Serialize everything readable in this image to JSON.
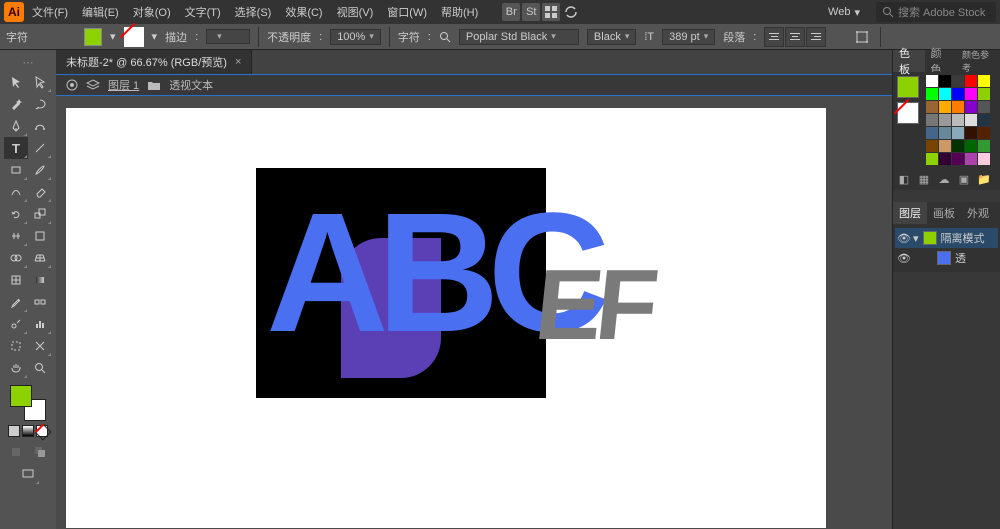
{
  "app_icon_text": "Ai",
  "menus": [
    "文件(F)",
    "编辑(E)",
    "对象(O)",
    "文字(T)",
    "选择(S)",
    "效果(C)",
    "视图(V)",
    "窗口(W)",
    "帮助(H)"
  ],
  "workspace": "Web",
  "search_placeholder": "搜索 Adobe Stock",
  "toolbar": {
    "char_label": "字符",
    "stroke_label": "描边",
    "stroke_val": "",
    "opacity_label": "不透明度",
    "opacity_val": "100%",
    "charset_label": "字符",
    "font_name": "Poplar Std Black",
    "font_style": "Black",
    "font_size": "389 pt",
    "para_label": "段落"
  },
  "tab_title": "未标题-2* @ 66.67% (RGB/预览)",
  "layerbar": {
    "layer_label": "图层 1",
    "item_label": "透视文本"
  },
  "panels": {
    "color_tabs": [
      "色板",
      "颜色",
      "颜色参考"
    ],
    "layer_tabs": [
      "图层",
      "画板",
      "外观"
    ],
    "layer1": "隔离模式",
    "layer2": "透"
  },
  "swatch_colors": [
    "#ffffff",
    "#000000",
    "#3a3a3a",
    "#ff0000",
    "#ffff00",
    "#00ff00",
    "#00ffff",
    "#0000ff",
    "#ff00ff",
    "#8ed100",
    "#996633",
    "#ffaa00",
    "#ff7c00",
    "#8800cc",
    "#555555",
    "#777777",
    "#999999",
    "#bbbbbb",
    "#dddddd",
    "#223344",
    "#446688",
    "#668899",
    "#88aabb",
    "#331100",
    "#552200",
    "#774400",
    "#cc9966",
    "#003300",
    "#006600",
    "#339933",
    "#8ed100",
    "#330033",
    "#550055",
    "#aa44aa",
    "#facade"
  ],
  "colors": {
    "fill": "#8ed100",
    "abc": "#4a6ff0",
    "shadow": "#5a3fb5",
    "ef": "#7a7a7a"
  }
}
